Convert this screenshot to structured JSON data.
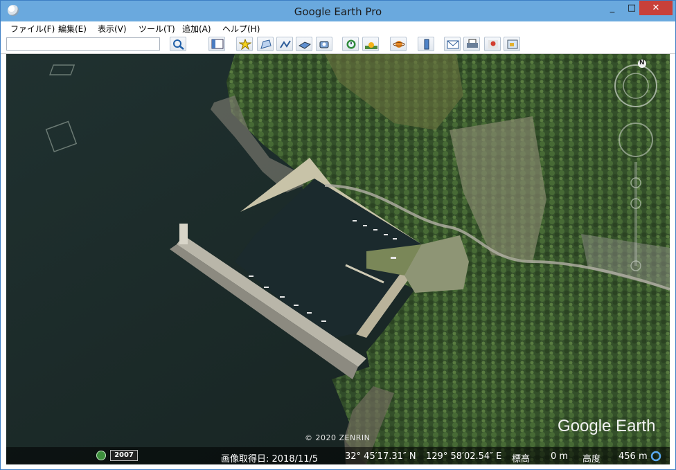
{
  "window": {
    "title": "Google Earth Pro"
  },
  "window_controls": {
    "minimize": "_",
    "maximize": "□",
    "close": "✕"
  },
  "menu": {
    "items": [
      "ファイル(F)",
      "編集(E)",
      "表示(V)",
      "ツール(T)",
      "追加(A)",
      "ヘルプ(H)"
    ]
  },
  "search": {
    "value": ""
  },
  "toolbar": {
    "buttons": [
      "search-icon",
      "sidebar-icon",
      "placemark-icon",
      "polygon-icon",
      "path-icon",
      "overlay-icon",
      "tour-icon",
      "historical-imagery-icon",
      "sunlight-icon",
      "planets-icon",
      "ruler-icon",
      "email-icon",
      "print-icon",
      "google-maps-icon",
      "image-export-icon"
    ]
  },
  "map": {
    "copyright": "© 2020 ZENRIN",
    "logo": "Google Earth",
    "compass_north": "N"
  },
  "status": {
    "year": "2007",
    "imagery_date": "画像取得日: 2018/11/5",
    "latitude": "32° 45′17.31″ N",
    "longitude": "129° 58′02.54″ E",
    "elevation_label": "標高",
    "elevation": "0 m",
    "altitude_label": "高度",
    "altitude": "456 m"
  },
  "colors": {
    "titlebar": "#6aa9de",
    "close": "#c8403a",
    "sea": "#1d2c2b",
    "forest": "#34502a"
  }
}
